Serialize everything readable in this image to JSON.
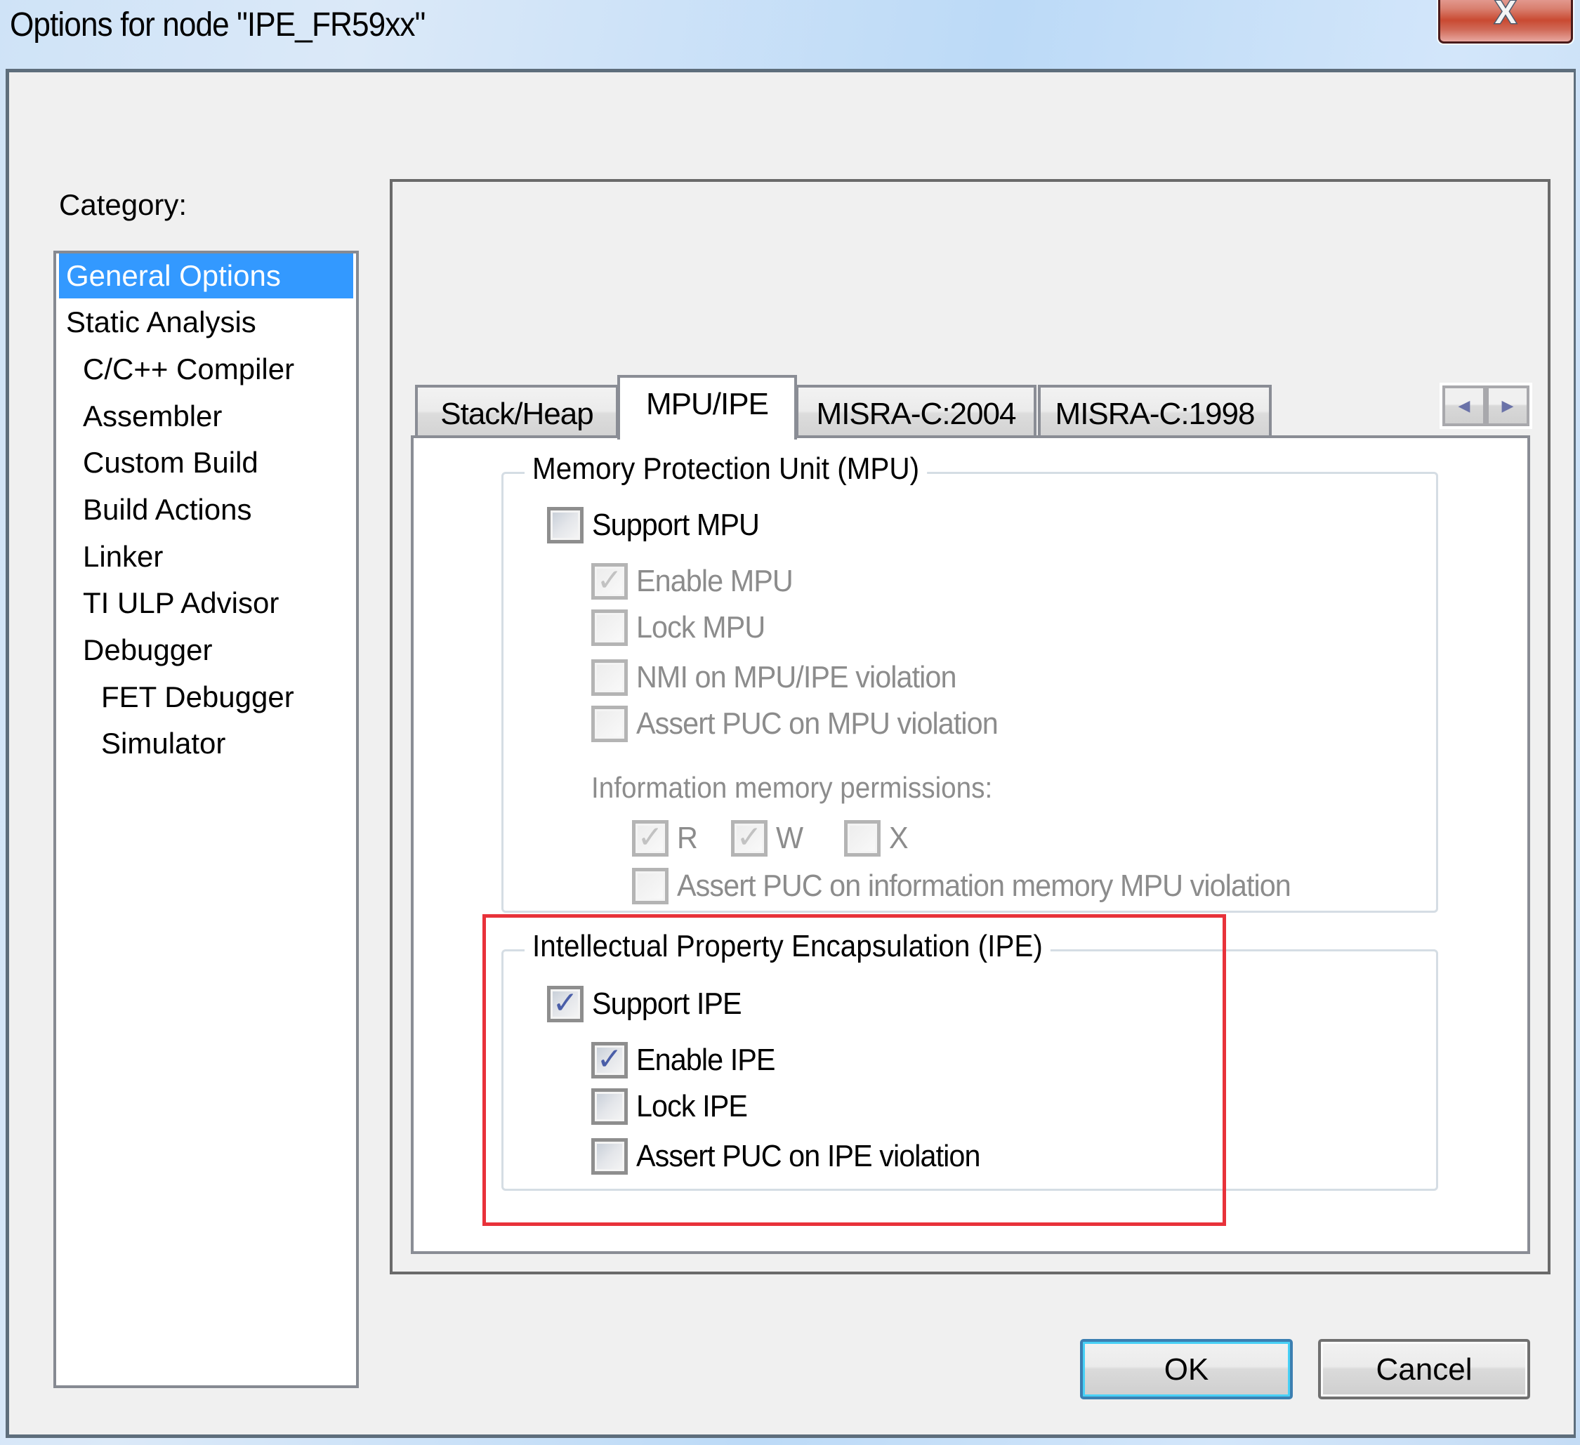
{
  "window": {
    "title": "Options for node \"IPE_FR59xx\"",
    "close_glyph": "X"
  },
  "category": {
    "label": "Category:",
    "items": [
      {
        "label": "General Options",
        "level": 0,
        "selected": true
      },
      {
        "label": "Static Analysis",
        "level": 0,
        "selected": false
      },
      {
        "label": "C/C++ Compiler",
        "level": 1,
        "selected": false
      },
      {
        "label": "Assembler",
        "level": 1,
        "selected": false
      },
      {
        "label": "Custom Build",
        "level": 1,
        "selected": false
      },
      {
        "label": "Build Actions",
        "level": 1,
        "selected": false
      },
      {
        "label": "Linker",
        "level": 1,
        "selected": false
      },
      {
        "label": "TI ULP Advisor",
        "level": 1,
        "selected": false
      },
      {
        "label": "Debugger",
        "level": 1,
        "selected": false
      },
      {
        "label": "FET Debugger",
        "level": 2,
        "selected": false
      },
      {
        "label": "Simulator",
        "level": 2,
        "selected": false
      }
    ]
  },
  "tabs": [
    {
      "label": "Stack/Heap",
      "active": false
    },
    {
      "label": "MPU/IPE",
      "active": true
    },
    {
      "label": "MISRA-C:2004",
      "active": false
    },
    {
      "label": "MISRA-C:1998",
      "active": false
    }
  ],
  "tab_scroll": {
    "left": "◀",
    "right": "▶"
  },
  "mpu_group": {
    "title": "Memory Protection Unit (MPU)",
    "support": {
      "label": "Support MPU",
      "checked": false,
      "enabled": true
    },
    "options": [
      {
        "label": "Enable MPU",
        "checked": true,
        "enabled": false
      },
      {
        "label": "Lock MPU",
        "checked": false,
        "enabled": false
      },
      {
        "label": "NMI on MPU/IPE violation",
        "checked": false,
        "enabled": false
      },
      {
        "label": "Assert PUC on MPU violation",
        "checked": false,
        "enabled": false
      }
    ],
    "info_memory": {
      "heading": "Information memory permissions:",
      "permissions": [
        {
          "label": "R",
          "checked": true,
          "enabled": false
        },
        {
          "label": "W",
          "checked": true,
          "enabled": false
        },
        {
          "label": "X",
          "checked": false,
          "enabled": false
        }
      ],
      "assert_puc": {
        "label": "Assert PUC on information memory MPU violation",
        "checked": false,
        "enabled": false
      }
    }
  },
  "ipe_group": {
    "title": "Intellectual Property Encapsulation (IPE)",
    "support": {
      "label": "Support IPE",
      "checked": true,
      "enabled": true
    },
    "options": [
      {
        "label": "Enable IPE",
        "checked": true,
        "enabled": true
      },
      {
        "label": "Lock IPE",
        "checked": false,
        "enabled": true
      },
      {
        "label": "Assert PUC on IPE violation",
        "checked": false,
        "enabled": true
      }
    ]
  },
  "highlight": {
    "color": "#e8323a"
  },
  "buttons": {
    "ok": "OK",
    "cancel": "Cancel"
  },
  "check_glyph": "✓"
}
